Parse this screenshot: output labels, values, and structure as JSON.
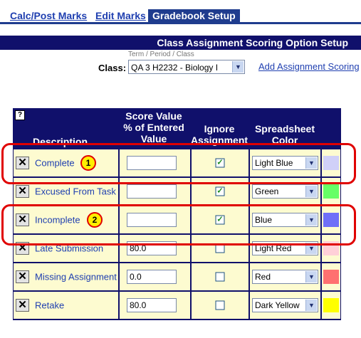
{
  "tabs": [
    {
      "label": "Calc/Post Marks"
    },
    {
      "label": "Edit Marks"
    },
    {
      "label": "Gradebook Setup"
    }
  ],
  "header": {
    "title": "Class Assignment Scoring Option Setup"
  },
  "class_picker": {
    "subtitle": "Term / Period / Class",
    "label": "Class:",
    "value": "QA  3  H2232 - Biology I"
  },
  "add_link": "Add Assignment Scoring",
  "table": {
    "help_icon": "?",
    "columns": {
      "description": "Description",
      "score_value": "Score Value\n% of Entered\nValue",
      "ignore": "Ignore\nAssignment",
      "color": "Spreadsheet\nColor"
    },
    "rows": [
      {
        "description": "Complete",
        "score": "",
        "ignore": true,
        "color": "Light Blue",
        "swatch": "#d0d0f8"
      },
      {
        "description": "Excused From Task",
        "score": "",
        "ignore": true,
        "color": "Green",
        "swatch": "#66ff66"
      },
      {
        "description": "Incomplete",
        "score": "",
        "ignore": true,
        "color": "Blue",
        "swatch": "#6f6ff8"
      },
      {
        "description": "Late Submission",
        "score": "80.0",
        "ignore": false,
        "color": "Light Red",
        "swatch": "#ffd0d8"
      },
      {
        "description": "Missing Assignment",
        "score": "0.0",
        "ignore": false,
        "color": "Red",
        "swatch": "#ff7070"
      },
      {
        "description": "Retake",
        "score": "80.0",
        "ignore": false,
        "color": "Dark Yellow",
        "swatch": "#ffff00"
      }
    ]
  },
  "annotations": [
    {
      "label": "1"
    },
    {
      "label": "2"
    }
  ]
}
